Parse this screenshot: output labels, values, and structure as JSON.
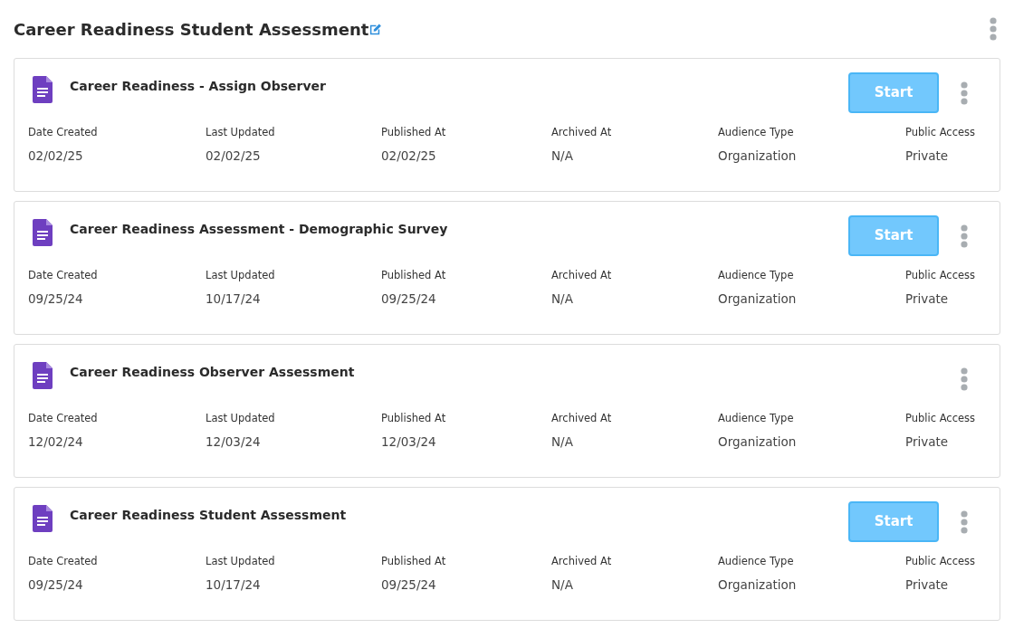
{
  "header": {
    "title": "Career Readiness Student Assessment"
  },
  "cards": [
    {
      "title": "Career Readiness - Assign Observer",
      "start_button": "Start",
      "fields": [
        {
          "label": "Date Created",
          "value": "02/02/25"
        },
        {
          "label": "Last Updated",
          "value": "02/02/25"
        },
        {
          "label": "Published At",
          "value": "02/02/25"
        },
        {
          "label": "Archived At",
          "value": "N/A"
        },
        {
          "label": "Audience Type",
          "value": "Organization"
        },
        {
          "label": "Public Access",
          "value": "Private"
        }
      ]
    },
    {
      "title": "Career Readiness Assessment - Demographic Survey",
      "start_button": "Start",
      "fields": [
        {
          "label": "Date Created",
          "value": "09/25/24"
        },
        {
          "label": "Last Updated",
          "value": "10/17/24"
        },
        {
          "label": "Published At",
          "value": "09/25/24"
        },
        {
          "label": "Archived At",
          "value": "N/A"
        },
        {
          "label": "Audience Type",
          "value": "Organization"
        },
        {
          "label": "Public Access",
          "value": "Private"
        }
      ]
    },
    {
      "title": "Career Readiness Observer Assessment",
      "fields": [
        {
          "label": "Date Created",
          "value": "12/02/24"
        },
        {
          "label": "Last Updated",
          "value": "12/03/24"
        },
        {
          "label": "Published At",
          "value": "12/03/24"
        },
        {
          "label": "Archived At",
          "value": "N/A"
        },
        {
          "label": "Audience Type",
          "value": "Organization"
        },
        {
          "label": "Public Access",
          "value": "Private"
        }
      ]
    },
    {
      "title": "Career Readiness Student Assessment",
      "start_button": "Start",
      "fields": [
        {
          "label": "Date Created",
          "value": "09/25/24"
        },
        {
          "label": "Last Updated",
          "value": "10/17/24"
        },
        {
          "label": "Published At",
          "value": "09/25/24"
        },
        {
          "label": "Archived At",
          "value": "N/A"
        },
        {
          "label": "Audience Type",
          "value": "Organization"
        },
        {
          "label": "Public Access",
          "value": "Private"
        }
      ]
    }
  ]
}
